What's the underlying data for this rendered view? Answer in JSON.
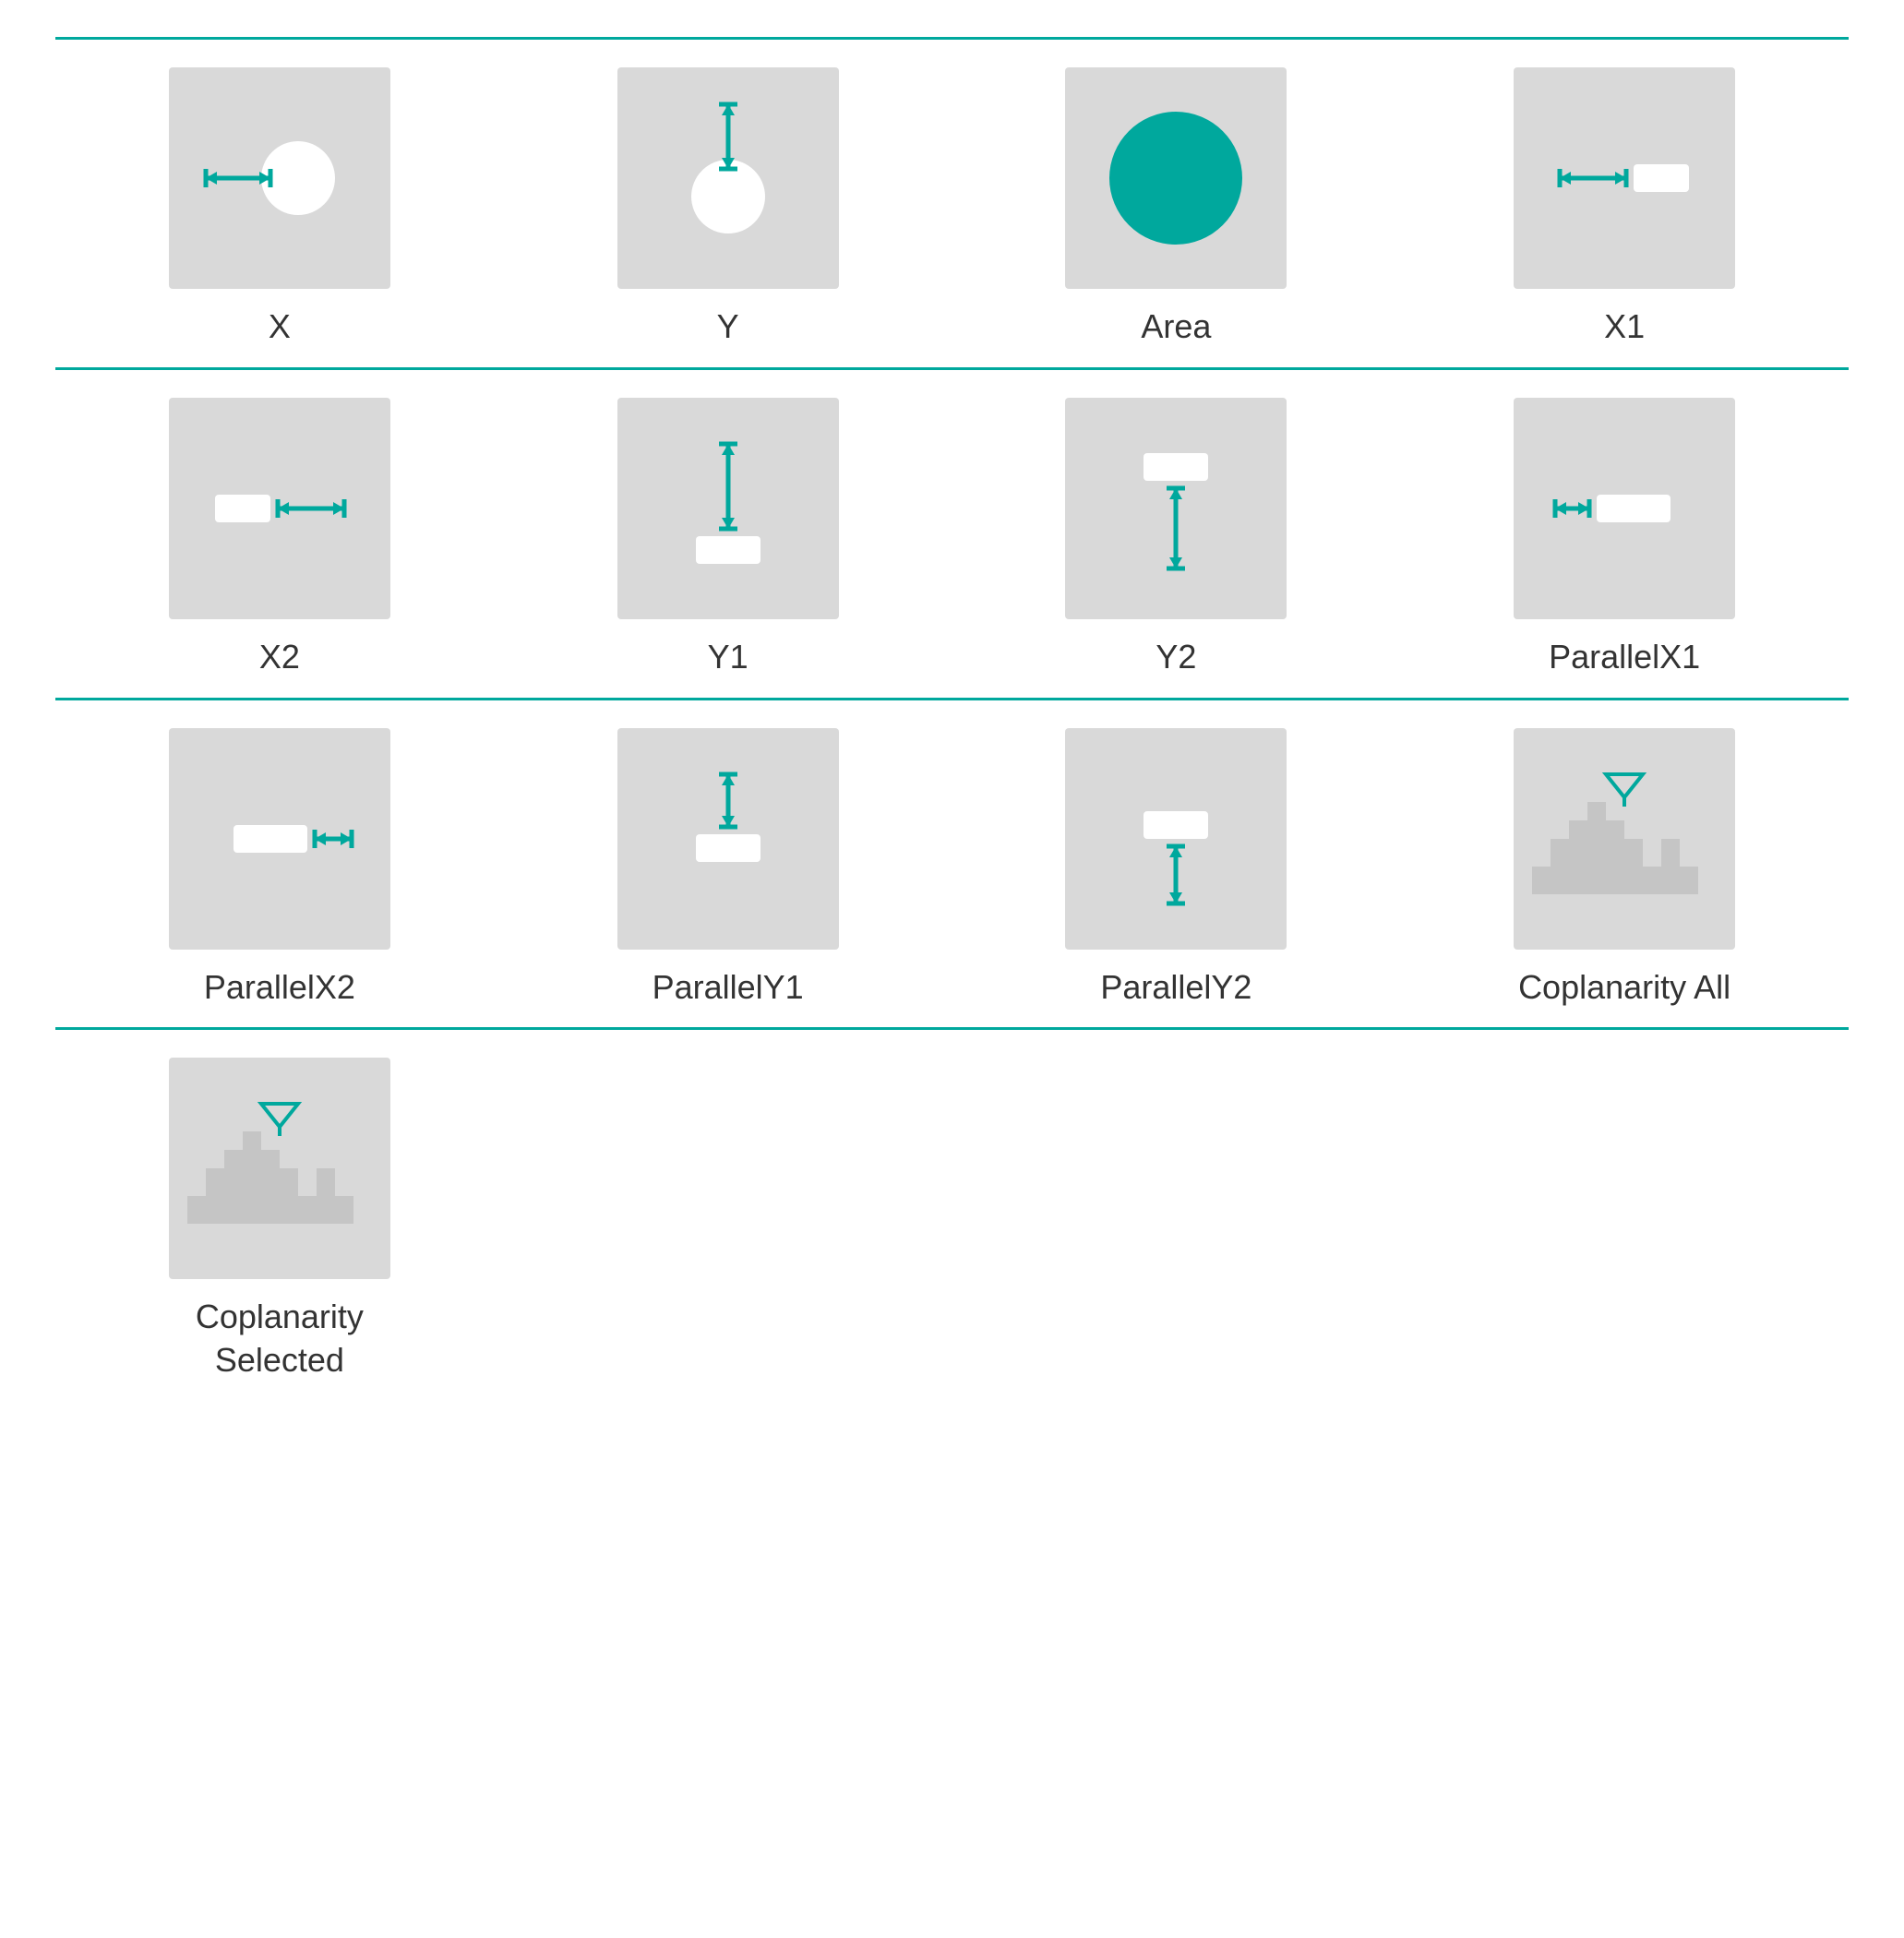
{
  "items": [
    {
      "id": "x",
      "label": "X",
      "type": "x"
    },
    {
      "id": "y",
      "label": "Y",
      "type": "y"
    },
    {
      "id": "area",
      "label": "Area",
      "type": "area"
    },
    {
      "id": "x1",
      "label": "X1",
      "type": "x1"
    },
    {
      "id": "x2",
      "label": "X2",
      "type": "x2"
    },
    {
      "id": "y1",
      "label": "Y1",
      "type": "y1"
    },
    {
      "id": "y2",
      "label": "Y2",
      "type": "y2"
    },
    {
      "id": "parallelx1",
      "label": "ParallelX1",
      "type": "parallelx1"
    },
    {
      "id": "parallelx2",
      "label": "ParallelX2",
      "type": "parallelx2"
    },
    {
      "id": "parallely1",
      "label": "ParallelY1",
      "type": "parallely1"
    },
    {
      "id": "parallely2",
      "label": "ParallelY2",
      "type": "parallely2"
    },
    {
      "id": "coplanarity-all",
      "label": "Coplanarity All",
      "type": "coplanarity-all"
    },
    {
      "id": "coplanarity-selected",
      "label": "Coplanarity\nSelected",
      "type": "coplanarity-selected"
    }
  ],
  "teal": "#00a89d",
  "gray": "#d9d9d9",
  "white": "#ffffff",
  "dark": "#444444"
}
